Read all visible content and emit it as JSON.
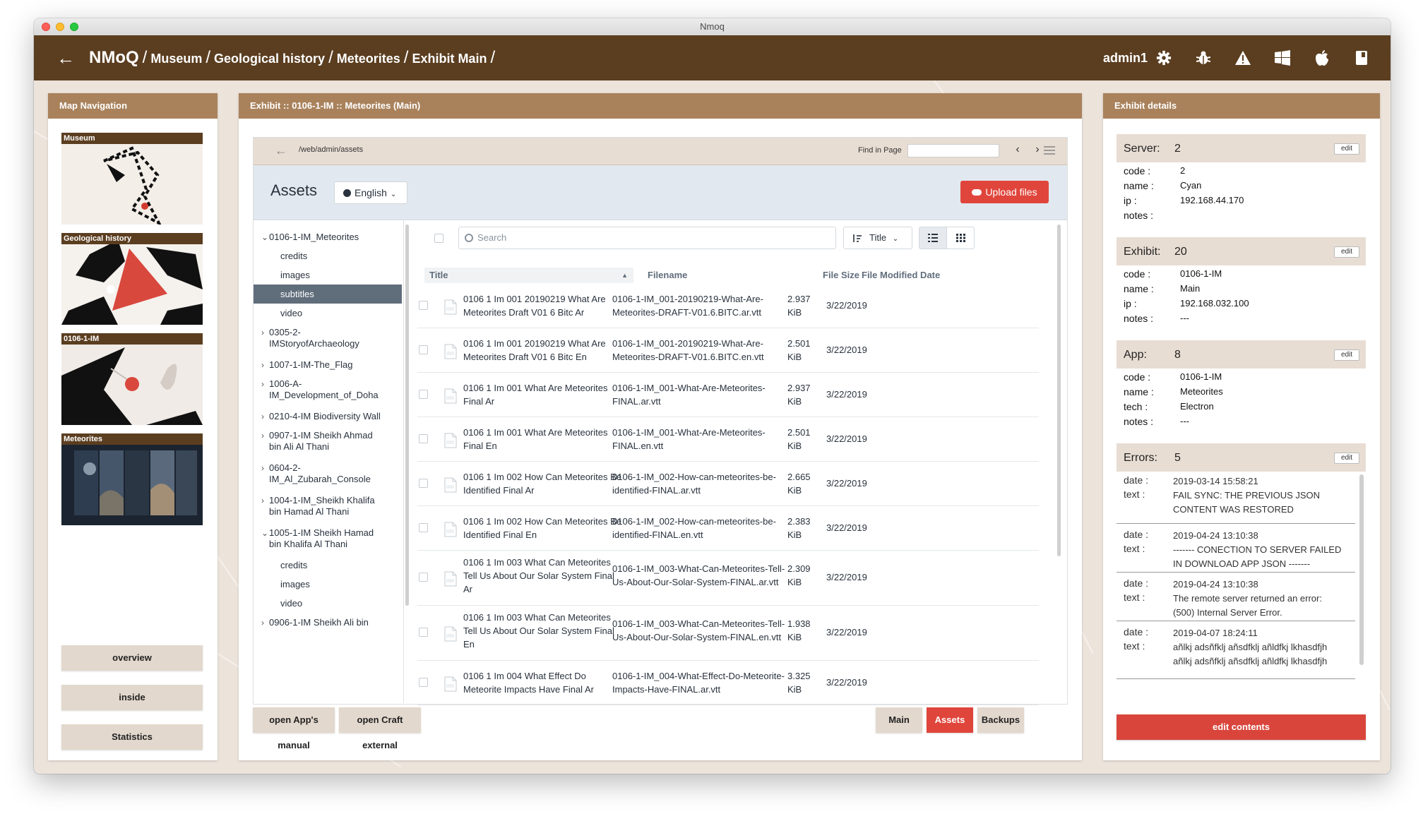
{
  "window": {
    "title": "Nmoq"
  },
  "header": {
    "root": "NMoQ",
    "separator": "/",
    "breadcrumbs": [
      "Museum",
      "Geological history",
      "Meteorites",
      "Exhibit Main"
    ],
    "user": "admin1",
    "icons": [
      "back-arrow-icon",
      "gear-icon",
      "bug-icon",
      "warning-icon",
      "windows-icon",
      "apple-icon",
      "book-icon"
    ]
  },
  "map_nav": {
    "title": "Map Navigation",
    "cards": [
      {
        "label": "Museum"
      },
      {
        "label": "Geological history"
      },
      {
        "label": "0106-1-IM"
      },
      {
        "label": "Meteorites"
      }
    ],
    "buttons": [
      "overview",
      "inside",
      "Statistics"
    ]
  },
  "exhibit": {
    "title": "Exhibit :: 0106-1-IM :: Meteorites (Main)",
    "craft": {
      "url": "/web/admin/assets",
      "find_label": "Find in Page",
      "heading": "Assets",
      "site": "English",
      "upload": "Upload files",
      "search_placeholder": "Search",
      "sort": "Title",
      "tree": [
        {
          "label": "0106-1-IM_Meteorites",
          "toggle": "⌄"
        },
        {
          "label": "credits"
        },
        {
          "label": "images"
        },
        {
          "label": "subtitles",
          "selected": true
        },
        {
          "label": "video"
        },
        {
          "label": "0305-2-IMStoryofArchaeology",
          "line1": "0305-2-",
          "line2": "IMStoryofArchaeology",
          "toggle": "›"
        },
        {
          "label": "1007-1-IM-The_Flag",
          "toggle": "›"
        },
        {
          "label": "1006-A-IM_Development_of_Doha",
          "line1": "1006-A-",
          "line2": "IM_Development_of_Doha",
          "toggle": "›"
        },
        {
          "label": "0210-4-IM Biodiversity Wall",
          "toggle": "›"
        },
        {
          "label": "0907-1-IM Sheikh Ahmad bin Ali Al Thani",
          "line1": "0907-1-IM Sheikh Ahmad",
          "line2": "bin Ali Al Thani",
          "toggle": "›"
        },
        {
          "label": "0604-2-IM_Al_Zubarah_Console",
          "line1": "0604-2-",
          "line2": "IM_Al_Zubarah_Console",
          "toggle": "›"
        },
        {
          "label": "1004-1-IM_Sheikh Khalifa bin Hamad Al Thani",
          "line1": "1004-1-IM_Sheikh Khalifa",
          "line2": "bin Hamad Al Thani",
          "toggle": "›"
        },
        {
          "label": "1005-1-IM Sheikh Hamad bin Khalifa Al Thani",
          "line1": "1005-1-IM Sheikh Hamad",
          "line2": "bin Khalifa Al Thani",
          "toggle": "⌄"
        },
        {
          "label": "credits"
        },
        {
          "label": "images"
        },
        {
          "label": "video"
        },
        {
          "label": "0906-1-IM Sheikh Ali bin",
          "toggle": "›"
        }
      ],
      "columns": [
        "Title",
        "Filename",
        "File Size",
        "File Modified Date"
      ],
      "rows": [
        {
          "title1": "0106 1 Im 001 20190219 What Are",
          "title2": "Meteorites Draft V01 6 Bitc Ar",
          "title3": "",
          "file1": "0106-1-IM_001-20190219-What-Are-",
          "file2": "Meteorites-DRAFT-V01.6.BITC.ar.vtt",
          "size": "2.937",
          "unit": "KiB",
          "date": "3/22/2019"
        },
        {
          "title1": "0106 1 Im 001 20190219 What Are",
          "title2": "Meteorites Draft V01 6 Bitc En",
          "title3": "",
          "file1": "0106-1-IM_001-20190219-What-Are-",
          "file2": "Meteorites-DRAFT-V01.6.BITC.en.vtt",
          "size": "2.501",
          "unit": "KiB",
          "date": "3/22/2019"
        },
        {
          "title1": "0106 1 Im 001 What Are Meteorites",
          "title2": "Final Ar",
          "title3": "",
          "file1": "0106-1-IM_001-What-Are-Meteorites-",
          "file2": "FINAL.ar.vtt",
          "size": "2.937",
          "unit": "KiB",
          "date": "3/22/2019"
        },
        {
          "title1": "0106 1 Im 001 What Are Meteorites",
          "title2": "Final En",
          "title3": "",
          "file1": "0106-1-IM_001-What-Are-Meteorites-",
          "file2": "FINAL.en.vtt",
          "size": "2.501",
          "unit": "KiB",
          "date": "3/22/2019"
        },
        {
          "title1": "0106 1 Im 002 How Can Meteorites Be",
          "title2": "Identified Final Ar",
          "title3": "",
          "file1": "0106-1-IM_002-How-can-meteorites-be-",
          "file2": "identified-FINAL.ar.vtt",
          "size": "2.665",
          "unit": "KiB",
          "date": "3/22/2019"
        },
        {
          "title1": "0106 1 Im 002 How Can Meteorites Be",
          "title2": "Identified Final En",
          "title3": "",
          "file1": "0106-1-IM_002-How-can-meteorites-be-",
          "file2": "identified-FINAL.en.vtt",
          "size": "2.383",
          "unit": "KiB",
          "date": "3/22/2019"
        },
        {
          "title1": "0106 1 Im 003 What Can Meteorites",
          "title2": "Tell Us About Our Solar System Final",
          "title3": "Ar",
          "file1": "0106-1-IM_003-What-Can-Meteorites-Tell-",
          "file2": "Us-About-Our-Solar-System-FINAL.ar.vtt",
          "size": "2.309",
          "unit": "KiB",
          "date": "3/22/2019"
        },
        {
          "title1": "0106 1 Im 003 What Can Meteorites",
          "title2": "Tell Us About Our Solar System Final",
          "title3": "En",
          "file1": "0106-1-IM_003-What-Can-Meteorites-Tell-",
          "file2": "Us-About-Our-Solar-System-FINAL.en.vtt",
          "size": "1.938",
          "unit": "KiB",
          "date": "3/22/2019"
        },
        {
          "title1": "0106 1 Im 004 What Effect Do",
          "title2": "Meteorite Impacts Have Final Ar",
          "title3": "",
          "file1": "0106-1-IM_004-What-Effect-Do-Meteorite-",
          "file2": "Impacts-Have-FINAL.ar.vtt",
          "size": "3.325",
          "unit": "KiB",
          "date": "3/22/2019"
        }
      ]
    },
    "footer_left": [
      "open App's manual",
      "open Craft external"
    ],
    "footer_right": [
      "Main",
      "Assets",
      "Backups"
    ],
    "active_tab": "Assets"
  },
  "details": {
    "title": "Exhibit details",
    "edit_label": "edit",
    "server": {
      "label": "Server:",
      "value": "2",
      "code": "2",
      "name": "Cyan",
      "ip": "192.168.44.170",
      "notes": ""
    },
    "exhibit": {
      "label": "Exhibit:",
      "value": "20",
      "code": "0106-1-IM",
      "name": "Main",
      "ip": "192.168.032.100",
      "notes": "---"
    },
    "app": {
      "label": "App:",
      "value": "8",
      "code": "0106-1-IM",
      "name": "Meteorites",
      "tech": "Electron",
      "notes": "---"
    },
    "errors": {
      "label": "Errors:",
      "value": "5",
      "items": [
        {
          "date": "2019-03-14 15:58:21",
          "text1": "FAIL SYNC: THE PREVIOUS JSON",
          "text2": "CONTENT WAS RESTORED"
        },
        {
          "date": "2019-04-24 13:10:38",
          "text1": "------- CONECTION TO SERVER FAILED",
          "text2": "IN DOWNLOAD APP JSON -------"
        },
        {
          "date": "2019-04-24 13:10:38",
          "text1": "The remote server returned an error:",
          "text2": "(500) Internal Server Error."
        },
        {
          "date": "2019-04-07 18:24:11",
          "text1": "añlkj adsñfklj añsdfklj añldfkj lkhasdfjh",
          "text2": "añlkj adsñfklj añsdfklj añldfkj lkhasdfjh"
        }
      ]
    },
    "labels": {
      "code": "code :",
      "name": "name :",
      "ip": "ip :",
      "notes": "notes :",
      "tech": "tech :",
      "date": "date :",
      "text": "text :"
    },
    "edit_contents": "edit contents"
  },
  "colors": {
    "brand": "#5b3e20",
    "panel_header": "#a9825c",
    "accent": "#e0453b",
    "selected_tree": "#606d7b"
  }
}
